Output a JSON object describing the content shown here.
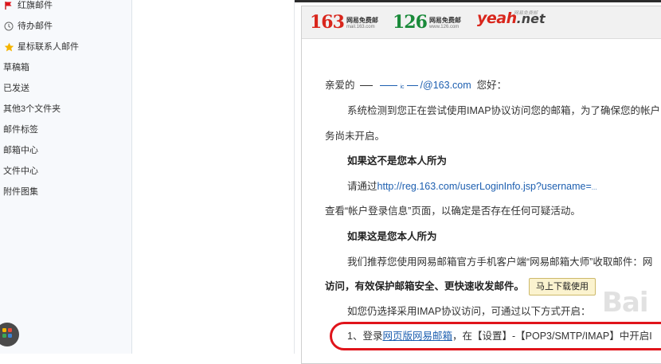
{
  "sidebar": {
    "items": [
      {
        "label": "红旗邮件",
        "icon": "red-flag-icon"
      },
      {
        "label": "待办邮件",
        "icon": "clock-icon"
      },
      {
        "label": "星标联系人邮件",
        "icon": "star-icon"
      },
      {
        "label": "草稿箱"
      },
      {
        "label": "已发送"
      },
      {
        "label": "其他3个文件夹"
      },
      {
        "label": "邮件标签"
      },
      {
        "label": "邮箱中心"
      },
      {
        "label": "文件中心"
      },
      {
        "label": "附件图集"
      }
    ],
    "apps_icon": "app-grid-icon"
  },
  "mail": {
    "logos": {
      "l163": {
        "num": "163",
        "title": "网易免费邮",
        "url": "mail.163.com",
        "color": "#d9261c"
      },
      "l126": {
        "num": "126",
        "title": "网易免费邮",
        "url": "www.126.com",
        "color": "#1a8a3a"
      },
      "yeah": {
        "word": "yeah",
        "suffix": ".net",
        "small": "网易免费邮"
      }
    },
    "greeting_prefix": "亲爱的",
    "email_partial": "/@163.com",
    "email_blurred_mid": "ic",
    "greeting_suffix": "您好：",
    "para1_line1": "系统检测到您正在尝试使用IMAP协议访问您的邮箱，为了确保您的帐户",
    "para1_line2": "务尚未开启。",
    "heading1": "如果这不是您本人所为",
    "para2_prefix": "请通过",
    "para2_link": "http://reg.163.com/userLoginInfo.jsp?username=",
    "para2_link_tail": "...",
    "para3": "查看“帐户登录信息”页面，以确定是否存在任何可疑活动。",
    "heading2": "如果这是您本人所为",
    "para4": "我们推荐您使用网易邮箱官方手机客户端“网易邮箱大师”收取邮件：网",
    "para5_bold": "访问，有效保护邮箱安全、更快速收发邮件。",
    "download_button": "马上下载使用",
    "para6": "如您仍选择采用IMAP协议访问，可通过以下方式开启：",
    "step1_prefix": "1、登录",
    "step1_link": "网页版网易邮箱",
    "step1_suffix": "，在【设置】-【POP3/SMTP/IMAP】中开启",
    "step1_tail": "I"
  },
  "watermark": "Bai"
}
